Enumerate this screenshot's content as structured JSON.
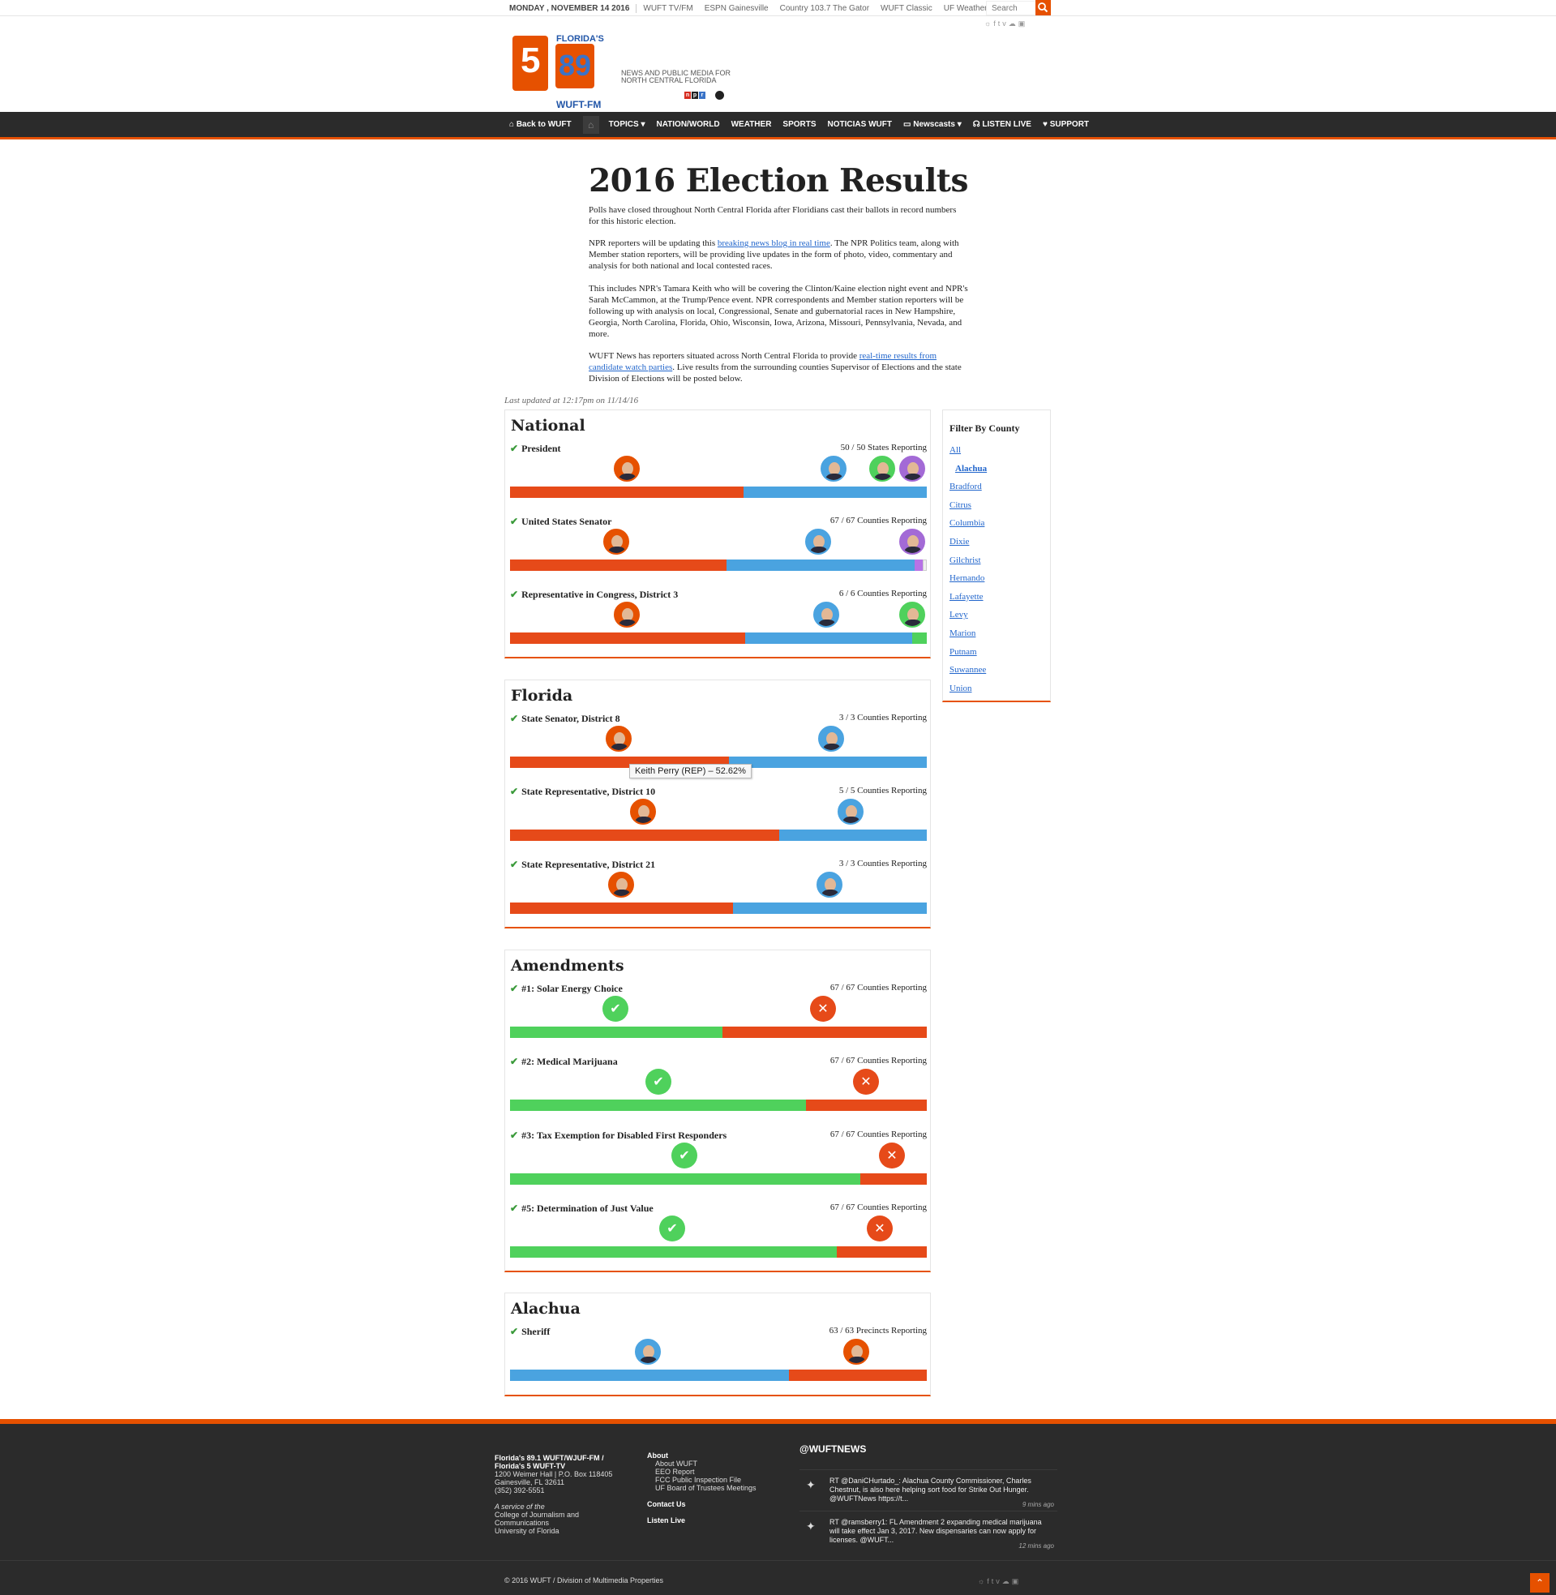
{
  "topbar": {
    "date": "MONDAY , NOVEMBER 14 2016",
    "links": [
      "WUFT TV/FM",
      "ESPN Gainesville",
      "Country 103.7 The Gator",
      "WUFT Classic",
      "UF Weather"
    ],
    "search_placeholder": "Search",
    "social_icons": [
      "rss-icon",
      "facebook-icon",
      "twitter-icon",
      "vimeo-icon",
      "soundcloud-icon",
      "instagram-icon"
    ]
  },
  "logo": {
    "top": "FLORIDA'S",
    "tv": "5",
    "fm": "89",
    "station": "WUFT-FM",
    "tagline": "NEWS AND PUBLIC MEDIA FOR NORTH CENTRAL FLORIDA",
    "npr": [
      "n",
      "p",
      "r"
    ]
  },
  "nav": {
    "items": [
      "Back to WUFT",
      "TOPICS",
      "NATION/WORLD",
      "WEATHER",
      "SPORTS",
      "NOTICIAS WUFT",
      "Newscasts",
      "LISTEN LIVE",
      "SUPPORT"
    ]
  },
  "page": {
    "title": "2016 Election Results",
    "p1": "Polls have closed throughout North Central Florida after Floridians cast their ballots in record numbers for this historic election.",
    "p2_before": "NPR reporters will be updating this ",
    "p2_link": "breaking news blog in real time",
    "p2_after": ". The NPR Politics team, along with Member station reporters, will be providing live updates in the form of photo, video, commentary and analysis for both national and local contested races.",
    "p3": "This includes NPR's Tamara Keith who will be covering the Clinton/Kaine election night event and NPR's Sarah McCammon, at the Trump/Pence event. NPR correspondents and Member station reporters will be following up with analysis on local, Congressional, Senate and gubernatorial races in New Hampshire, Georgia, North Carolina, Florida, Ohio, Wisconsin, Iowa, Arizona, Missouri, Pennsylvania, Nevada, and more.",
    "p4_before": "WUFT News has reporters situated across North Central Florida to provide ",
    "p4_link": "real-time results from candidate watch parties",
    "p4_after": ". Live results from the surrounding counties Supervisor of Elections and the state Division of Elections will be posted below.",
    "updated": "Last updated at 12:17pm on 11/14/16"
  },
  "sections": {
    "national": {
      "title": "National",
      "races": [
        {
          "name": "President",
          "reporting": "50 / 50 States Reporting",
          "shares": [
            0.56,
            0.44
          ]
        },
        {
          "name": "United States Senator",
          "reporting": "67 / 67 Counties Reporting",
          "shares": [
            0.52,
            0.45,
            0.02,
            0.01
          ]
        },
        {
          "name": "Representative in Congress, District 3",
          "reporting": "6 / 6 Counties Reporting",
          "shares": [
            0.565,
            0.4,
            0.035
          ]
        }
      ]
    },
    "florida": {
      "title": "Florida",
      "races": [
        {
          "name": "State Senator, District 8",
          "reporting": "3 / 3 Counties Reporting",
          "shares": [
            0.5262,
            0.4738
          ]
        },
        {
          "name": "State Representative, District 10",
          "reporting": "5 / 5 Counties Reporting",
          "shares": [
            0.645,
            0.355
          ]
        },
        {
          "name": "State Representative, District 21",
          "reporting": "3 / 3 Counties Reporting",
          "shares": [
            0.535,
            0.465
          ]
        }
      ]
    },
    "amendments": {
      "title": "Amendments",
      "races": [
        {
          "name": "#1: Solar Energy Choice",
          "reporting": "67 / 67 Counties Reporting",
          "shares": [
            0.51,
            0.49
          ]
        },
        {
          "name": "#2: Medical Marijuana",
          "reporting": "67 / 67 Counties Reporting",
          "shares": [
            0.71,
            0.29
          ]
        },
        {
          "name": "#3: Tax Exemption for Disabled First Responders",
          "reporting": "67 / 67 Counties Reporting",
          "shares": [
            0.84,
            0.16
          ]
        },
        {
          "name": "#5: Determination of Just Value",
          "reporting": "67 / 67 Counties Reporting",
          "shares": [
            0.785,
            0.215
          ]
        }
      ]
    },
    "alachua": {
      "title": "Alachua",
      "races": [
        {
          "name": "Sheriff",
          "reporting": "63 / 63 Precincts Reporting",
          "shares": [
            0.67,
            0.33
          ]
        }
      ]
    }
  },
  "tooltip": "Keith Perry (REP) – 52.62%",
  "filter": {
    "title": "Filter By County",
    "counties": [
      "All",
      "Alachua",
      "Bradford",
      "Citrus",
      "Columbia",
      "Dixie",
      "Gilchrist",
      "Hernando",
      "Lafayette",
      "Levy",
      "Marion",
      "Putnam",
      "Suwannee",
      "Union"
    ]
  },
  "footer": {
    "station_name_1": "Florida's 89.1 WUFT/WJUF-FM /",
    "station_name_2": "Florida's 5 WUFT-TV",
    "address_1": "1200 Weimer Hall | P.O. Box 118405",
    "address_2": "Gainesville, FL 32611",
    "phone": "(352) 392-5551",
    "service_of": "A service of the",
    "college_1": "College of Journalism and",
    "college_2": "Communications",
    "university": "University of Florida",
    "about": "About",
    "about_links": [
      "About WUFT",
      "EEO Report",
      "FCC Public Inspection File",
      "UF Board of Trustees Meetings"
    ],
    "contact": "Contact Us",
    "listen": "Listen Live",
    "twitter_handle": "@WUFTNEWS",
    "tweets": [
      {
        "text": "RT @DaniCHurtado_: Alachua County Commissioner, Charles Chestnut, is also here helping sort food for Strike Out Hunger. @WUFTNews https://t...",
        "ago": "9 mins ago"
      },
      {
        "text": "RT @ramsberry1: FL Amendment 2 expanding medical marijuana will take effect Jan 3, 2017. New dispensaries can now apply for licenses. @WUFT...",
        "ago": "12 mins ago"
      }
    ],
    "copyright": "© 2016 WUFT / Division of Multimedia Properties"
  },
  "colors": {
    "accent": "#e65100",
    "rep": "#e64a19",
    "dem": "#4aa3e0",
    "green": "#4fd15c",
    "purple": "#b772e6",
    "nav_bg": "#2b2b2b"
  }
}
